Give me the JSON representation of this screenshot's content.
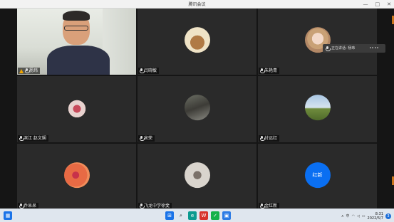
{
  "window": {
    "title": "腾讯会议",
    "controls": [
      "—",
      "□",
      "✕"
    ]
  },
  "participants": [
    {
      "name": "杨玮",
      "type": "video",
      "mic": true,
      "warning": true
    },
    {
      "name": "闫晓敏",
      "type": "avatar",
      "avatar_color": "#efe3c6"
    },
    {
      "name": "朱艳青",
      "type": "avatar",
      "avatar_color": "#e8c2b4"
    },
    {
      "name": "滨江 赵文娴",
      "type": "avatar",
      "avatar_color": "#d9c9c7"
    },
    {
      "name": "宋荣",
      "type": "avatar",
      "avatar_color": "#4a4a45"
    },
    {
      "name": "付远红",
      "type": "avatar",
      "avatar_color": "#8db2d6"
    },
    {
      "name": "乔呆呆",
      "type": "avatar",
      "avatar_color": "#e15a3c"
    },
    {
      "name": "飞龙中学徐斐",
      "type": "avatar",
      "avatar_color": "#c7c2bb"
    },
    {
      "name": "金红新",
      "type": "text-avatar",
      "avatar_text": "红新",
      "avatar_color": "#0a6ff2"
    }
  ],
  "speaking_popup": {
    "label": "正在讲话: 杨玮"
  },
  "taskbar": {
    "apps": [
      {
        "name": "start",
        "color": "#1a73e8",
        "glyph": "⊞"
      },
      {
        "name": "search",
        "color": "#2b2b2b",
        "glyph": "⌕"
      },
      {
        "name": "edge",
        "color": "#0b9a8f",
        "glyph": "e"
      },
      {
        "name": "wps",
        "color": "#d8322b",
        "glyph": "W"
      },
      {
        "name": "wechat",
        "color": "#14b14a",
        "glyph": "✓"
      },
      {
        "name": "meeting",
        "color": "#2c7be5",
        "glyph": "▣"
      }
    ],
    "left_icon": {
      "name": "weather",
      "color": "#1a73e8"
    },
    "tray_text": "中",
    "time": "8:31",
    "date": "2022/5/7",
    "notification_count": "3"
  }
}
